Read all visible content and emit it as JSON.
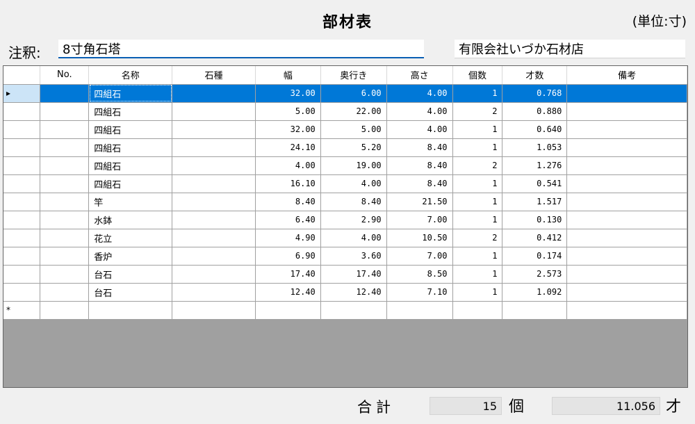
{
  "header": {
    "title": "部材表",
    "unit": "(単位:寸)"
  },
  "note": {
    "label": "注釈:",
    "value": "8寸角石塔"
  },
  "company": {
    "value": "有限会社いづか石材店"
  },
  "table": {
    "columns": [
      "No.",
      "名称",
      "石種",
      "幅",
      "奥行き",
      "高さ",
      "個数",
      "才数",
      "備考"
    ],
    "selected_row_marker": "▸",
    "new_row_marker": "*",
    "rows": [
      {
        "no": "",
        "name": "四組石",
        "stone": "",
        "width": "32.00",
        "depth": "6.00",
        "height": "4.00",
        "count": "1",
        "sai": "0.768",
        "note": ""
      },
      {
        "no": "",
        "name": "四組石",
        "stone": "",
        "width": "5.00",
        "depth": "22.00",
        "height": "4.00",
        "count": "2",
        "sai": "0.880",
        "note": ""
      },
      {
        "no": "",
        "name": "四組石",
        "stone": "",
        "width": "32.00",
        "depth": "5.00",
        "height": "4.00",
        "count": "1",
        "sai": "0.640",
        "note": ""
      },
      {
        "no": "",
        "name": "四組石",
        "stone": "",
        "width": "24.10",
        "depth": "5.20",
        "height": "8.40",
        "count": "1",
        "sai": "1.053",
        "note": ""
      },
      {
        "no": "",
        "name": "四組石",
        "stone": "",
        "width": "4.00",
        "depth": "19.00",
        "height": "8.40",
        "count": "2",
        "sai": "1.276",
        "note": ""
      },
      {
        "no": "",
        "name": "四組石",
        "stone": "",
        "width": "16.10",
        "depth": "4.00",
        "height": "8.40",
        "count": "1",
        "sai": "0.541",
        "note": ""
      },
      {
        "no": "",
        "name": "竿",
        "stone": "",
        "width": "8.40",
        "depth": "8.40",
        "height": "21.50",
        "count": "1",
        "sai": "1.517",
        "note": ""
      },
      {
        "no": "",
        "name": "水鉢",
        "stone": "",
        "width": "6.40",
        "depth": "2.90",
        "height": "7.00",
        "count": "1",
        "sai": "0.130",
        "note": ""
      },
      {
        "no": "",
        "name": "花立",
        "stone": "",
        "width": "4.90",
        "depth": "4.00",
        "height": "10.50",
        "count": "2",
        "sai": "0.412",
        "note": ""
      },
      {
        "no": "",
        "name": "香炉",
        "stone": "",
        "width": "6.90",
        "depth": "3.60",
        "height": "7.00",
        "count": "1",
        "sai": "0.174",
        "note": ""
      },
      {
        "no": "",
        "name": "台石",
        "stone": "",
        "width": "17.40",
        "depth": "17.40",
        "height": "8.50",
        "count": "1",
        "sai": "2.573",
        "note": ""
      },
      {
        "no": "",
        "name": "台石",
        "stone": "",
        "width": "12.40",
        "depth": "12.40",
        "height": "7.10",
        "count": "1",
        "sai": "1.092",
        "note": ""
      }
    ]
  },
  "footer": {
    "total_label": "合計",
    "count_total": "15",
    "count_unit": "個",
    "sai_total": "11.056",
    "sai_unit": "才"
  },
  "colors": {
    "selection": "#0078d7",
    "note_underline": "#0a5fb4",
    "grid_empty": "#a0a0a0"
  }
}
